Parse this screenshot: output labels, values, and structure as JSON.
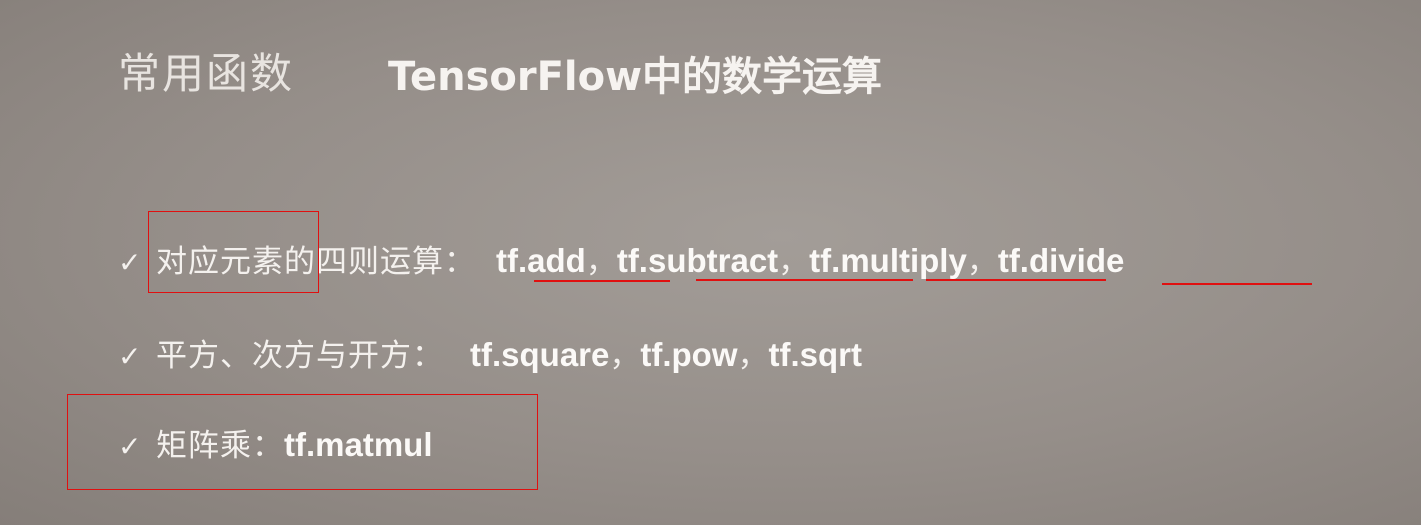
{
  "slide": {
    "category": "常用函数",
    "title": "TensorFlow中的数学运算"
  },
  "bullets": [
    {
      "check": "✓",
      "label": "对应元素的四则运算：",
      "funcs": [
        "tf.add",
        "tf.subtract",
        "tf.multiply",
        "tf.divide"
      ],
      "sep": "，"
    },
    {
      "check": "✓",
      "label": "平方、次方与开方：",
      "funcs": [
        "tf.square",
        "tf.pow",
        "tf.sqrt"
      ],
      "sep": "，"
    },
    {
      "check": "✓",
      "label": "矩阵乘：",
      "funcs": [
        "tf.matmul"
      ]
    }
  ],
  "colors": {
    "background": "#958e89",
    "text": "#f4f1ee",
    "annotation": "#e01010"
  }
}
